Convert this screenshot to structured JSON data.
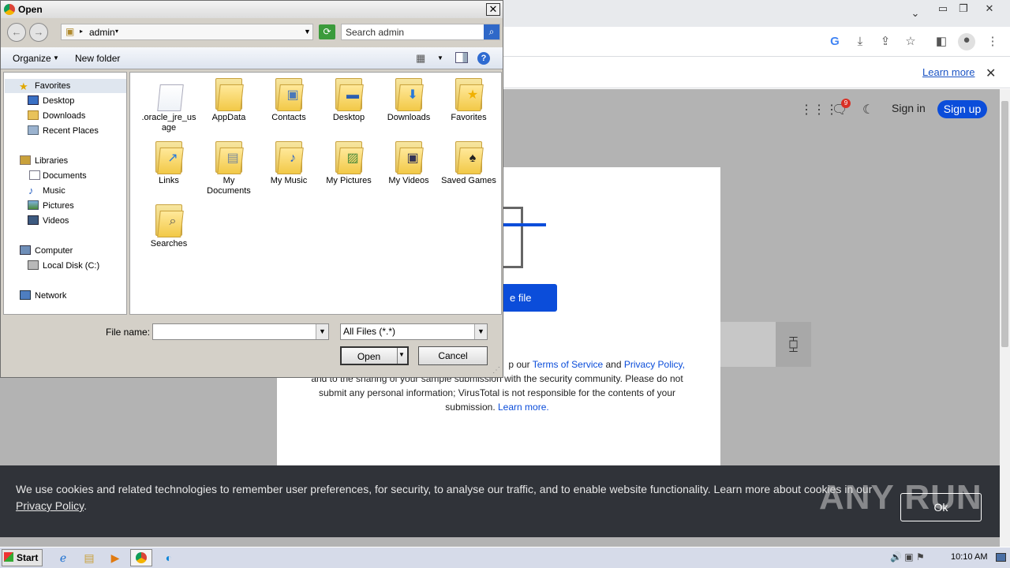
{
  "chrome": {
    "learn_more": "Learn more",
    "sign_in": "Sign in",
    "sign_up": "Sign up",
    "notif_count": "9"
  },
  "modal": {
    "choose_button_fragment": "e file",
    "terms_line1_pre": "p our ",
    "terms_link": "Terms of Service",
    "terms_and": " and ",
    "privacy_link": "Privacy Policy,",
    "terms_line2": "and to the sharing of your sample submission with the security community. Please do not submit any personal information; VirusTotal is not responsible for the contents of your submission.",
    "learn_more": "Learn more."
  },
  "cookie": {
    "text": "We use cookies and related technologies to remember user preferences, for security, to analyse our traffic, and to enable website functionality. Learn more about cookies in our",
    "privacy_link": "Privacy Policy",
    "ok": "Ok",
    "watermark": "ANY RUN"
  },
  "taskbar": {
    "start": "Start",
    "clock": "10:10 AM"
  },
  "dialog": {
    "title": "Open",
    "address": "admin",
    "search_placeholder": "Search admin",
    "organize": "Organize",
    "new_folder": "New folder",
    "nav": {
      "favorites": "Favorites",
      "desktop": "Desktop",
      "downloads": "Downloads",
      "recent_places": "Recent Places",
      "libraries": "Libraries",
      "documents": "Documents",
      "music": "Music",
      "pictures": "Pictures",
      "videos": "Videos",
      "computer": "Computer",
      "local_disk": "Local Disk (C:)",
      "network": "Network"
    },
    "files": [
      ".oracle_jre_usage",
      "AppData",
      "Contacts",
      "Desktop",
      "Downloads",
      "Favorites",
      "Links",
      "My Documents",
      "My Music",
      "My Pictures",
      "My Videos",
      "Saved Games",
      "Searches"
    ],
    "file_name_label": "File name:",
    "file_name_value": "",
    "file_type": "All Files (*.*)",
    "open": "Open",
    "cancel": "Cancel"
  }
}
